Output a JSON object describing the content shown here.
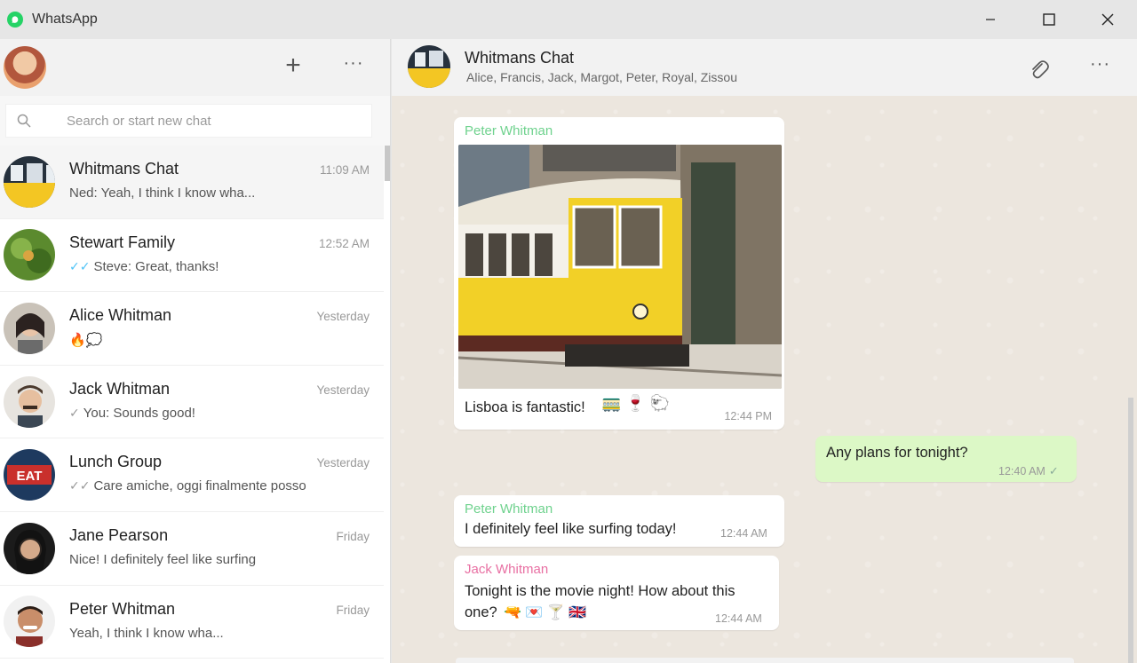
{
  "window": {
    "title": "WhatsApp",
    "controls": [
      "minimize",
      "maximize",
      "close"
    ]
  },
  "left": {
    "new_chat_label": "+",
    "menu_label": "···",
    "search": {
      "placeholder": "Search or start new chat"
    },
    "chats": [
      {
        "name": "Whitmans Chat",
        "time": "11:09 AM",
        "preview": "Ned: Yeah, I think I know wha...",
        "tick": ""
      },
      {
        "name": "Stewart Family",
        "time": "12:52 AM",
        "preview": "Steve: Great, thanks!",
        "tick": "✓✓"
      },
      {
        "name": "Alice Whitman",
        "time": "Yesterday",
        "preview": "🔥💭",
        "tick": ""
      },
      {
        "name": "Jack Whitman",
        "time": "Yesterday",
        "preview": "You: Sounds good!",
        "tick": "✓"
      },
      {
        "name": "Lunch Group",
        "time": "Yesterday",
        "preview": "Care amiche, oggi finalmente posso",
        "tick": "✓✓"
      },
      {
        "name": "Jane Pearson",
        "time": "Friday",
        "preview": "Nice! I definitely feel like surfing",
        "tick": ""
      },
      {
        "name": "Peter Whitman",
        "time": "Friday",
        "preview": "Yeah, I think I know wha...",
        "tick": ""
      }
    ]
  },
  "conversation": {
    "name": "Whitmans Chat",
    "members": "Alice, Francis, Jack, Margot, Peter, Royal, Zissou",
    "menu_label": "···",
    "messages": [
      {
        "sender": "Peter Whitman",
        "text": "Lisboa is fantastic!",
        "emojis": "🚃 🍷 🐑",
        "time": "12:44 PM"
      },
      {
        "sender": "",
        "text": "Any plans for tonight?",
        "time": "12:40 AM",
        "status": "✓"
      },
      {
        "sender": "Peter Whitman",
        "text": "I definitely feel like surfing today!",
        "time": "12:44 AM"
      },
      {
        "sender": "Jack Whitman",
        "text_line1": "Tonight is the movie night! How about this",
        "text_line2": "one?",
        "emojis": "🔫 💌 🍸 🇬🇧",
        "time": "12:44 AM"
      }
    ]
  },
  "colors": {
    "accent_green": "#25d366",
    "sender_green": "#6fd28e",
    "sender_pink": "#e86fa2",
    "outgoing_bubble": "#dcf8c6",
    "read_tick": "#4fc3f7"
  }
}
